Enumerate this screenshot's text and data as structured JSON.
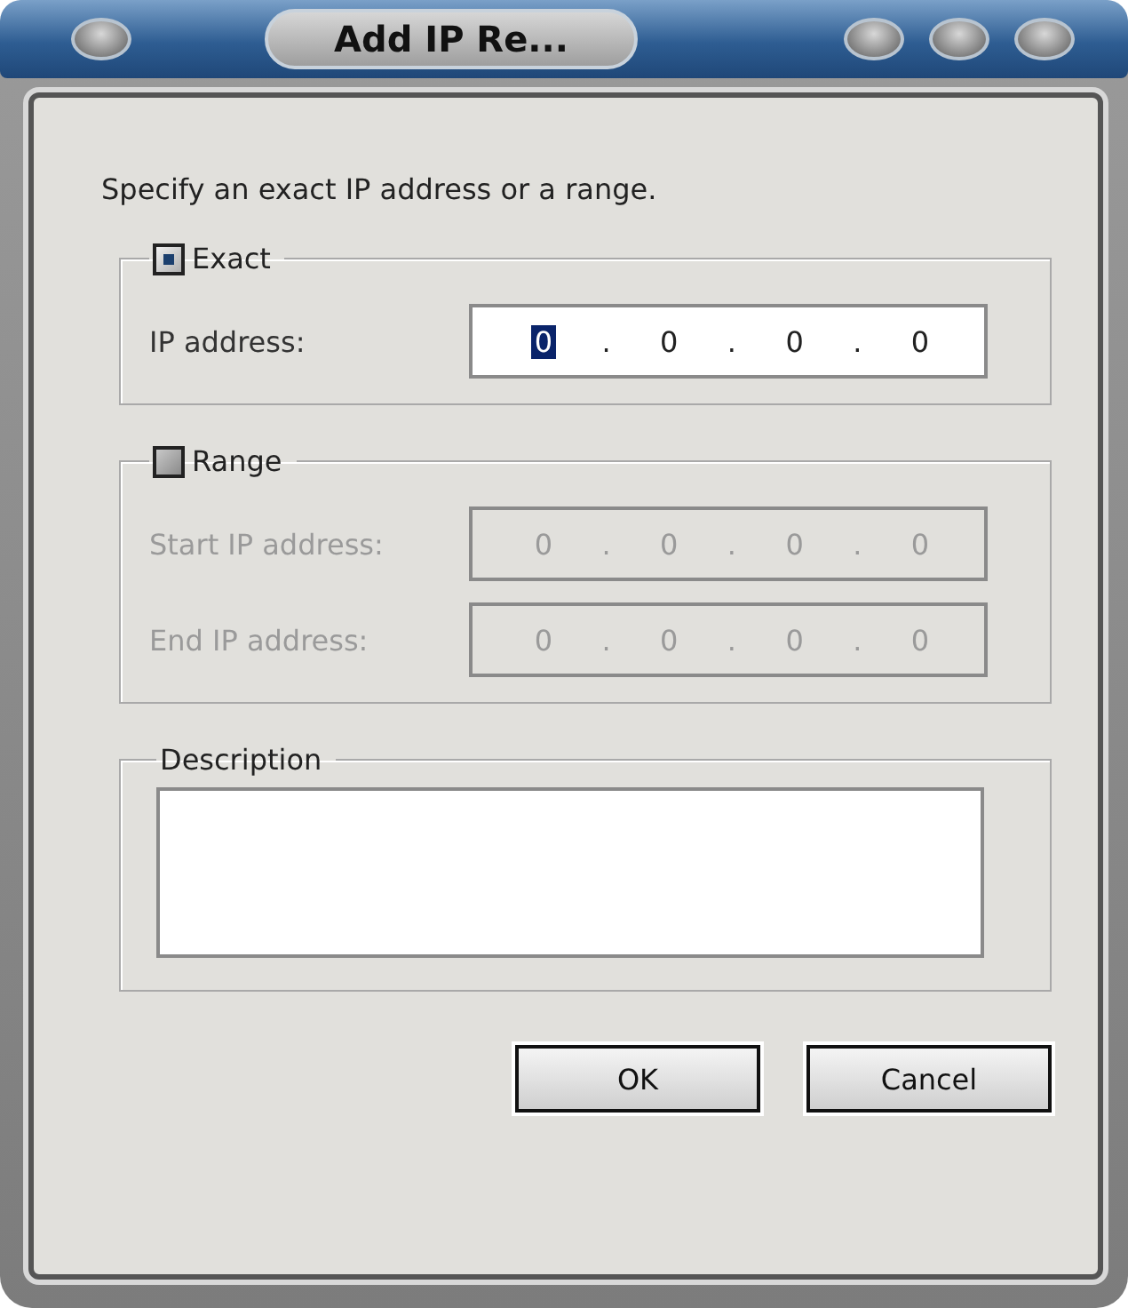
{
  "window": {
    "title": "Add IP Re..."
  },
  "instruction": "Specify an exact IP address or a range.",
  "groups": [
    {
      "kind": "checkbox",
      "label": "Exact",
      "checked": true,
      "disabled": false,
      "rows": [
        {
          "label": "IP address:",
          "octets": [
            {
              "text": "0",
              "selected": true
            },
            {
              "text": "0",
              "selected": false
            },
            {
              "text": "0",
              "selected": false
            },
            {
              "text": "0",
              "selected": false
            }
          ],
          "separators": [
            ".",
            ".",
            "."
          ]
        }
      ]
    },
    {
      "kind": "checkbox",
      "label": "Range",
      "checked": false,
      "disabled": true,
      "rows": [
        {
          "label": "Start IP address:",
          "octets": [
            {
              "text": "0",
              "selected": false
            },
            {
              "text": "0",
              "selected": false
            },
            {
              "text": "0",
              "selected": false
            },
            {
              "text": "0",
              "selected": false
            }
          ],
          "separators": [
            ".",
            ".",
            "."
          ]
        },
        {
          "label": "End IP address:",
          "octets": [
            {
              "text": "0",
              "selected": false
            },
            {
              "text": "0",
              "selected": false
            },
            {
              "text": "0",
              "selected": false
            },
            {
              "text": "0",
              "selected": false
            }
          ],
          "separators": [
            ".",
            ".",
            "."
          ]
        }
      ]
    },
    {
      "kind": "text",
      "label": "Description"
    }
  ],
  "buttons": [
    "OK",
    "Cancel"
  ]
}
